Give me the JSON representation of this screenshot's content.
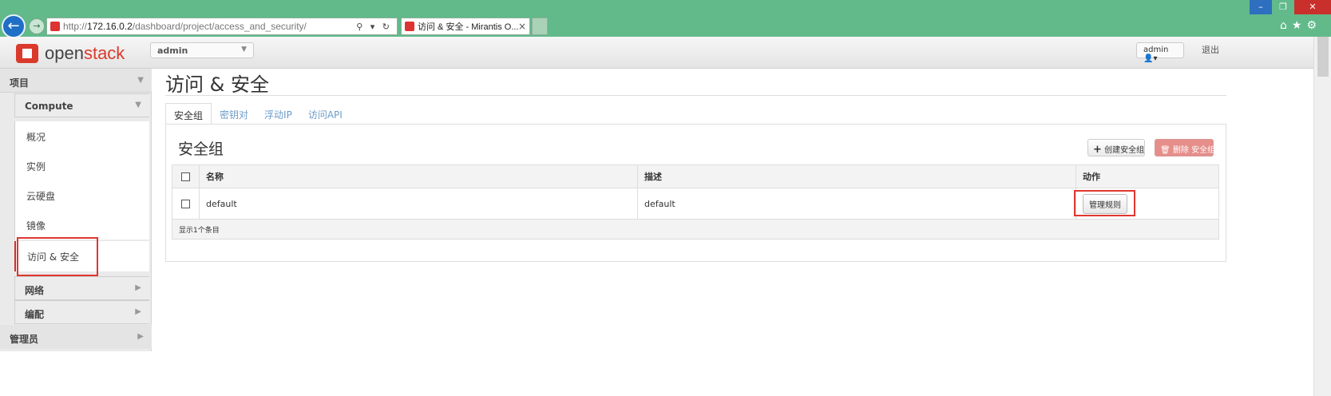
{
  "browser": {
    "url_prefix": "http://",
    "url_host": "172.16.0.2",
    "url_path": "/dashboard/project/access_and_security/",
    "tab_title": "访问 & 安全 - Mirantis O...",
    "tab_close": "×",
    "address_tools": "⚲ ▾ ↻"
  },
  "topbar": {
    "logo_text_a": "open",
    "logo_text_b": "stack",
    "project_selector": "admin",
    "user_menu": "admin",
    "logout": "退出"
  },
  "sidebar": {
    "section_project": "项目",
    "group_compute": "Compute",
    "items": [
      "概况",
      "实例",
      "云硬盘",
      "镜像",
      "访问 & 安全"
    ],
    "group_network": "网络",
    "group_orchestration": "编配",
    "section_admin": "管理员"
  },
  "main": {
    "page_title": "访问 & 安全",
    "tabs": [
      "安全组",
      "密钥对",
      "浮动IP",
      "访问API"
    ],
    "panel_title": "安全组",
    "create_button": "创建安全组",
    "delete_button": "删除 安全组",
    "table": {
      "headers": [
        "名称",
        "描述",
        "动作"
      ],
      "rows": [
        {
          "name": "default",
          "description": "default",
          "action": "管理规则"
        }
      ],
      "footer": "显示1个条目"
    }
  },
  "colors": {
    "chrome": "#62b98a",
    "accent_red": "#da3a2c",
    "highlight_box": "#e0362f",
    "link_blue": "#6c9bc9"
  }
}
